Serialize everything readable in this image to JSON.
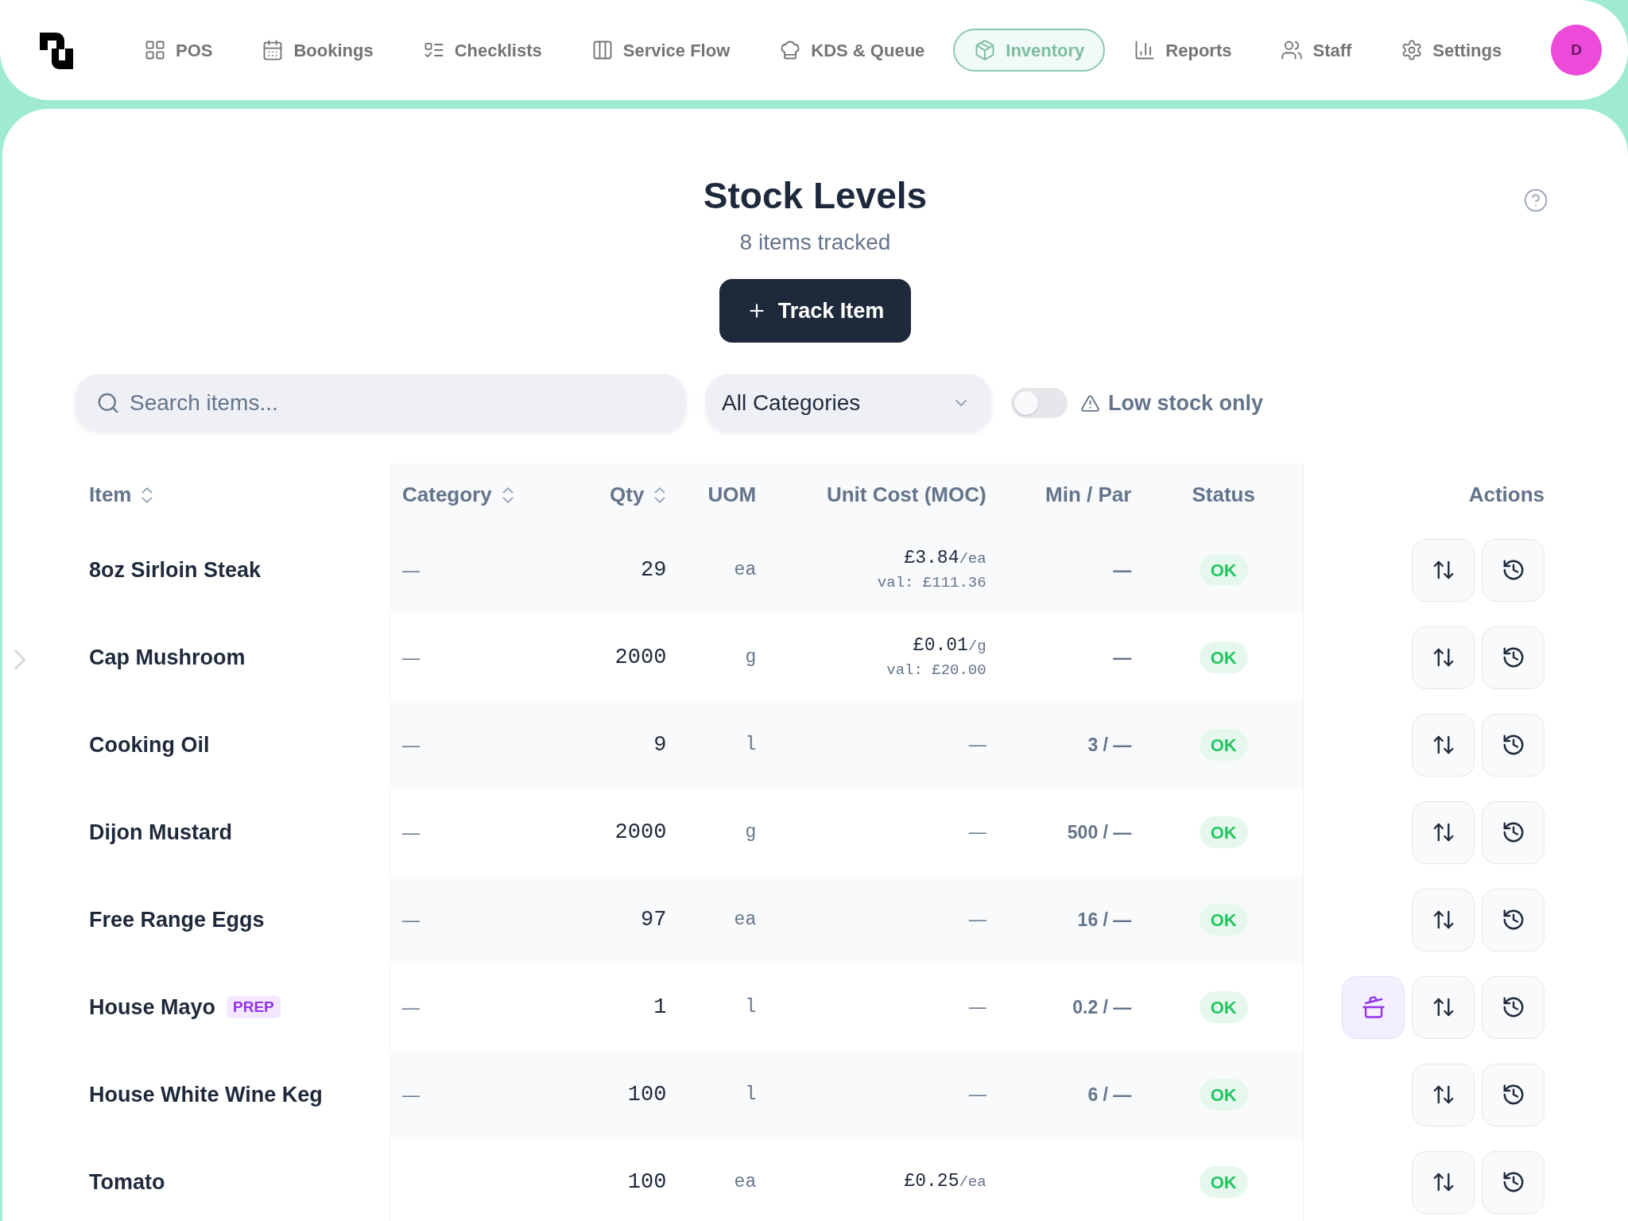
{
  "nav": {
    "items": [
      {
        "label": "POS",
        "selected": false
      },
      {
        "label": "Bookings",
        "selected": false
      },
      {
        "label": "Checklists",
        "selected": false
      },
      {
        "label": "Service Flow",
        "selected": false
      },
      {
        "label": "KDS & Queue",
        "selected": false
      },
      {
        "label": "Inventory",
        "selected": true
      },
      {
        "label": "Reports",
        "selected": false
      },
      {
        "label": "Staff",
        "selected": false
      },
      {
        "label": "Settings",
        "selected": false
      }
    ],
    "avatar": {
      "initial": "D"
    }
  },
  "header": {
    "title": "Stock Levels",
    "subtitle": "8 items tracked",
    "add_button": "Track Item"
  },
  "filters": {
    "search": {
      "placeholder": "Search items..."
    },
    "category": {
      "value": "All Categories"
    },
    "low_stock_toggle": {
      "label": "Low stock only",
      "on": false
    }
  },
  "table": {
    "columns": [
      {
        "label": "Item",
        "sortable": true
      },
      {
        "label": "Category",
        "sortable": true
      },
      {
        "label": "Qty",
        "sortable": true
      },
      {
        "label": "UOM",
        "sortable": false
      },
      {
        "label": "Unit Cost (MOC)",
        "sortable": false
      },
      {
        "label": "Min / Par",
        "sortable": false
      },
      {
        "label": "Status",
        "sortable": false
      },
      {
        "label": "Actions",
        "sortable": false
      }
    ],
    "rows": [
      {
        "item": "8oz Sirloin Steak",
        "category": "—",
        "qty": "29",
        "uom": "ea",
        "unit_cost": {
          "price": "£3.84",
          "unit": "/ea",
          "value": "val: £111.36"
        },
        "min_par": "—",
        "status": "OK",
        "prep_button": false
      },
      {
        "item": "Cap Mushroom",
        "category": "—",
        "qty": "2000",
        "uom": "g",
        "unit_cost": {
          "price": "£0.01",
          "unit": "/g",
          "value": "val: £20.00"
        },
        "min_par": "—",
        "status": "OK",
        "prep_button": false
      },
      {
        "item": "Cooking Oil",
        "category": "—",
        "qty": "9",
        "uom": "l",
        "unit_cost": {
          "price": "—"
        },
        "min_par": "3 / —",
        "status": "OK",
        "prep_button": false
      },
      {
        "item": "Dijon Mustard",
        "category": "—",
        "qty": "2000",
        "uom": "g",
        "unit_cost": {
          "price": "—"
        },
        "min_par": "500 / —",
        "status": "OK",
        "prep_button": false
      },
      {
        "item": "Free Range Eggs",
        "category": "—",
        "qty": "97",
        "uom": "ea",
        "unit_cost": {
          "price": "—"
        },
        "min_par": "16 / —",
        "status": "OK",
        "prep_button": false
      },
      {
        "item": "House Mayo",
        "tag": "PREP",
        "category": "—",
        "qty": "1",
        "uom": "l",
        "unit_cost": {
          "price": "—"
        },
        "min_par": "0.2 / —",
        "status": "OK",
        "prep_button": true
      },
      {
        "item": "House White Wine Keg",
        "category": "—",
        "qty": "100",
        "uom": "l",
        "unit_cost": {
          "price": "—"
        },
        "min_par": "6 / —",
        "status": "OK",
        "prep_button": false
      },
      {
        "item": "Tomato",
        "qty": "100",
        "uom": "ea",
        "unit_cost": {
          "price": "£0.25",
          "unit": "/ea"
        },
        "status": "OK",
        "prep_button": false
      }
    ]
  }
}
